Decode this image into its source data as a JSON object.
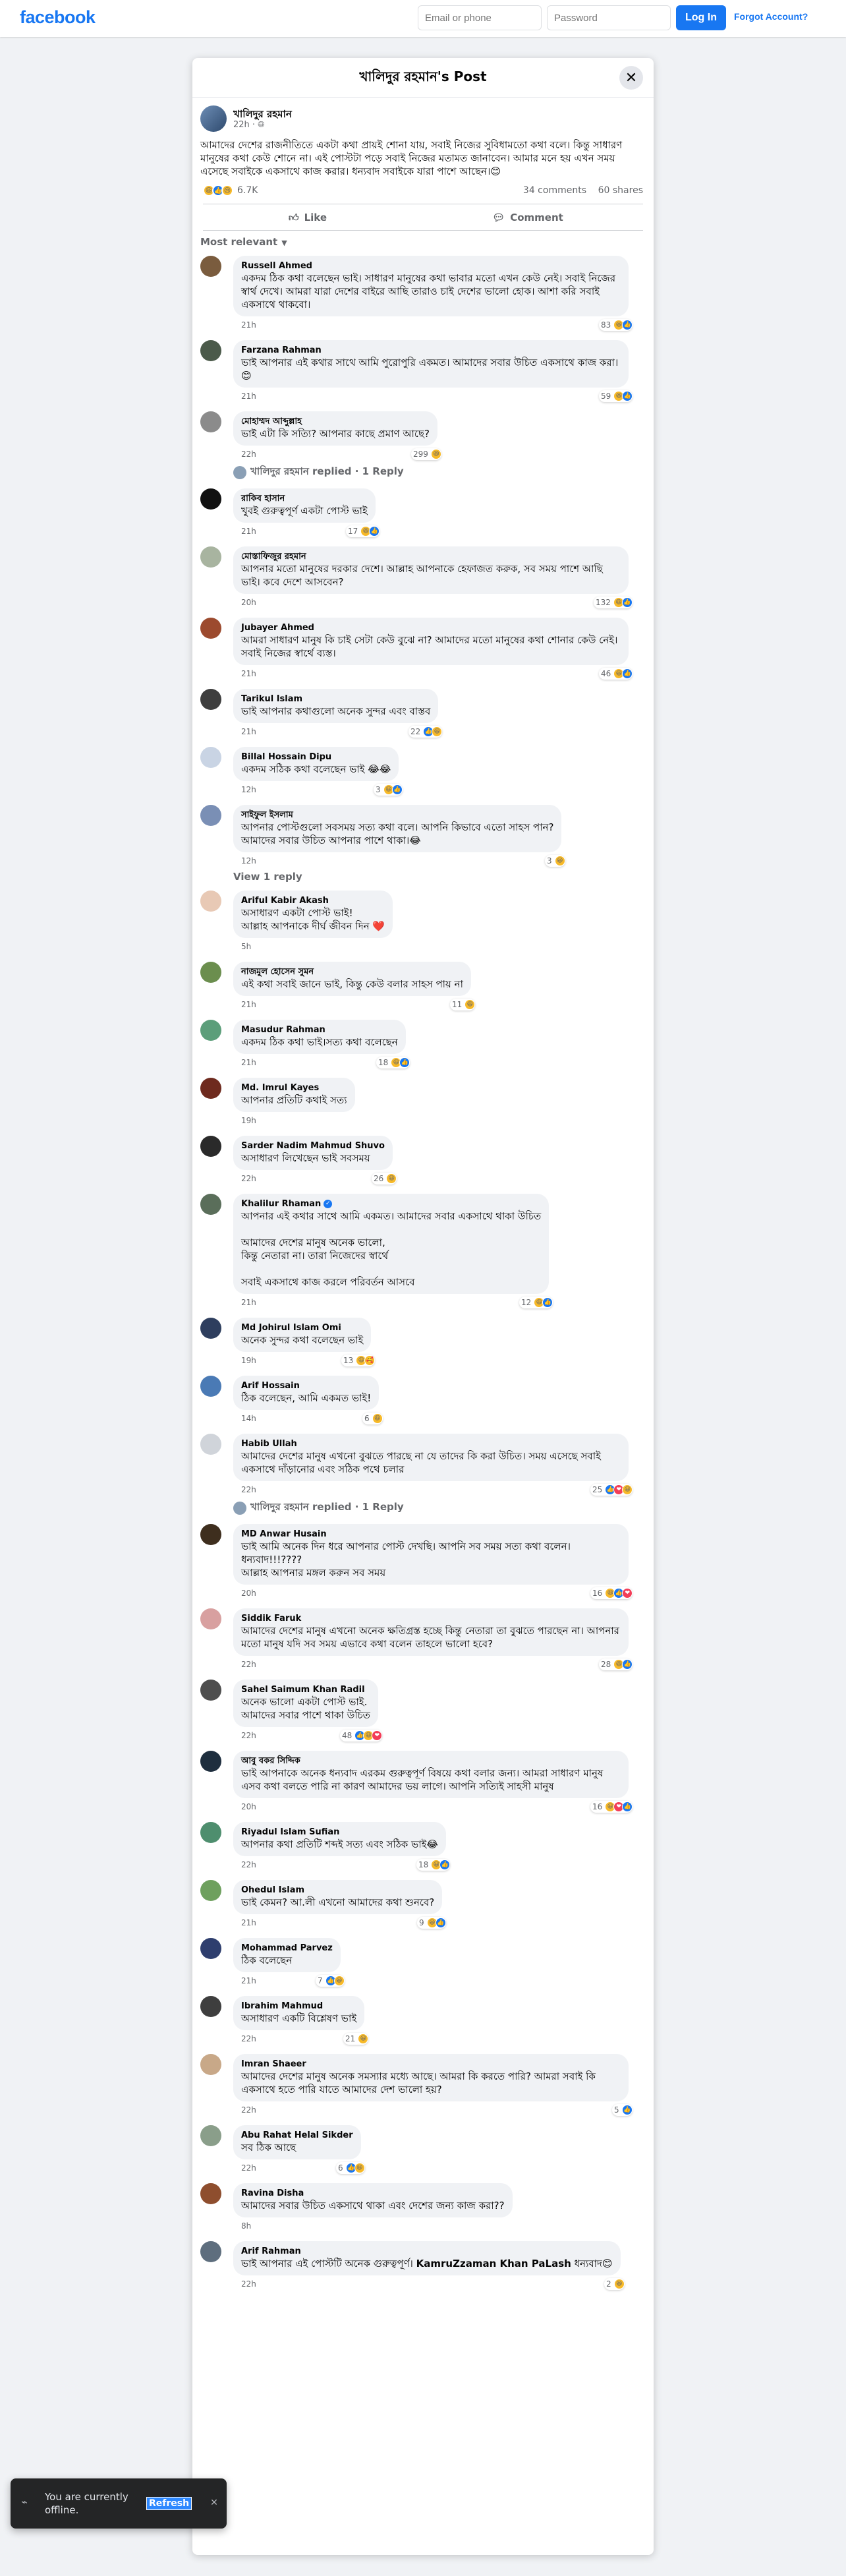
{
  "topbar": {
    "logo": "facebook",
    "email_placeholder": "Email or phone",
    "password_placeholder": "Password",
    "login_label": "Log In",
    "forgot_label": "Forgot Account?"
  },
  "dialog": {
    "title": "খালিদুর রহমান's Post",
    "close_icon": "close-icon"
  },
  "post": {
    "author": "খালিদুর রহমান",
    "time": "22h",
    "privacy_icon": "globe-icon",
    "text": "আমাদের দেশের রাজনীতিতে একটা কথা প্রায়ই শোনা যায়, সবাই নিজের সুবিধামতো কথা বলে। কিন্তু সাধারণ মানুষের কথা কেউ শোনে না। এই পোস্টটা পড়ে সবাই নিজের মতামত জানাবেন। আমার মনে হয় এখন সময় এসেছে সবাইকে একসাথে কাজ করার। ধন্যবাদ সবাইকে যারা পাশে আছেন।😊",
    "reaction_count": "6.7K",
    "comments_count": "34 comments",
    "shares_count": "60 shares",
    "like_label": "Like",
    "comment_label": "Comment",
    "sort_label": "Most relevant"
  },
  "comments": [
    {
      "name": "Russell Ahmed",
      "text": "একদম ঠিক কথা বলেছেন ভাই। সাধারণ মানুষের কথা ভাবার মতো এখন কেউ নেই। সবাই নিজের স্বার্থ দেখে। আমরা যারা দেশের বাইরে আছি তারাও চাই দেশের ভালো হোক। আশা করি সবাই একসাথে থাকবো।",
      "time": "21h",
      "count": "83",
      "reacts": [
        "haha",
        "like"
      ],
      "avatar": "#7a5c3e"
    },
    {
      "name": "Farzana Rahman",
      "text": "ভাই আপনার এই কথার সাথে আমি পুরোপুরি একমত। আমাদের সবার উচিত একসাথে কাজ করা।😊",
      "time": "21h",
      "count": "59",
      "reacts": [
        "haha",
        "like"
      ],
      "avatar": "#4b5a4a"
    },
    {
      "name": "মোহাম্মদ আব্দুল্লাহ",
      "text": "ভাই এটা কি সত্যি? আপনার কাছে প্রমাণ আছে?",
      "time": "22h",
      "count": "299",
      "reacts": [
        "haha"
      ],
      "avatar": "#8b8b8b",
      "replied": "খালিদুর রহমান replied · 1 Reply"
    },
    {
      "name": "রাকিব হাসান",
      "text": "খুবই গুরুত্বপূর্ণ একটা পোস্ট ভাই",
      "time": "21h",
      "count": "17",
      "reacts": [
        "haha",
        "like"
      ],
      "avatar": "#111111"
    },
    {
      "name": "মোস্তাফিজুর রহমান",
      "text": "আপনার মতো মানুষের দরকার দেশে। আল্লাহ আপনাকে হেফাজত করুক, সব সময় পাশে আছি ভাই। কবে দেশে আসবেন?",
      "time": "20h",
      "count": "132",
      "reacts": [
        "haha",
        "like"
      ],
      "avatar": "#a8b4a0"
    },
    {
      "name": "Jubayer Ahmed",
      "text": "আমরা সাধারণ মানুষ কি চাই সেটা কেউ বুঝে না? আমাদের মতো মানুষের কথা শোনার কেউ নেই। সবাই নিজের স্বার্থে ব্যস্ত।",
      "time": "21h",
      "count": "46",
      "reacts": [
        "haha",
        "like"
      ],
      "avatar": "#9c4a2e"
    },
    {
      "name": "Tarikul Islam",
      "text": "ভাই আপনার কথাগুলো অনেক সুন্দর এবং বাস্তব",
      "time": "21h",
      "count": "22",
      "reacts": [
        "like",
        "haha"
      ],
      "avatar": "#3e3e3e"
    },
    {
      "name": "Billal Hossain Dipu",
      "text": "একদম সঠিক কথা বলেছেন ভাই 😂😂",
      "time": "12h",
      "count": "3",
      "reacts": [
        "haha",
        "like"
      ],
      "avatar": "#c9d4e4"
    },
    {
      "name": "সাইফুল ইসলাম",
      "text": "আপনার পোস্টগুলো সবসময় সত্য কথা বলে। আপনি কিভাবে এতো সাহস পান?\nআমাদের সবার উচিত আপনার পাশে থাকা।😂",
      "time": "12h",
      "count": "3",
      "reacts": [
        "haha"
      ],
      "avatar": "#7a8fb5",
      "view_reply": "View 1 reply"
    },
    {
      "name": "Ariful Kabir Akash",
      "text": "অসাধারণ একটা পোস্ট ভাই!\nআল্লাহ আপনাকে দীর্ঘ জীবন দিন ❤️",
      "time": "5h",
      "avatar": "#e8c9b5"
    },
    {
      "name": "নাজমুল হোসেন সুমন",
      "text": "এই কথা সবাই জানে ভাই, কিন্তু কেউ বলার সাহস পায় না",
      "time": "21h",
      "count": "11",
      "reacts": [
        "haha"
      ],
      "avatar": "#6b8e4e"
    },
    {
      "name": "Masudur Rahman",
      "text": "একদম ঠিক কথা ভাই।সত্য কথা বলেছেন",
      "time": "21h",
      "count": "18",
      "reacts": [
        "haha",
        "like"
      ],
      "avatar": "#5c9e7a"
    },
    {
      "name": "Md. Imrul Kayes",
      "text": "আপনার প্রতিটি কথাই সত্য",
      "time": "19h",
      "avatar": "#6e2a1e"
    },
    {
      "name": "Sarder Nadim Mahmud Shuvo",
      "text": "অসাধারণ লিখেছেন ভাই সবসময়",
      "time": "22h",
      "count": "26",
      "reacts": [
        "haha"
      ],
      "avatar": "#2a2a2a"
    },
    {
      "name": "Khalilur Rhaman",
      "verified": true,
      "text": "আপনার এই কথার সাথে আমি একমত। আমাদের সবার একসাথে থাকা উচিত\n\nআমাদের দেশের মানুষ অনেক ভালো,\nকিন্তু নেতারা না। তারা নিজেদের স্বার্থে\n\nসবাই একসাথে কাজ করলে পরিবর্তন আসবে",
      "time": "21h",
      "count": "12",
      "reacts": [
        "haha",
        "like"
      ],
      "avatar": "#5a6e5a"
    },
    {
      "name": "Md Johirul Islam Omi",
      "text": "অনেক সুন্দর কথা বলেছেন ভাই",
      "time": "19h",
      "count": "13",
      "reacts": [
        "haha",
        "care"
      ],
      "avatar": "#2e3e5e"
    },
    {
      "name": "Arif Hossain",
      "text": "ঠিক বলেছেন, আমি একমত ভাই!",
      "time": "14h",
      "count": "6",
      "reacts": [
        "haha"
      ],
      "avatar": "#4a7ab5"
    },
    {
      "name": "Habib Ullah",
      "text": "আমাদের দেশের মানুষ এখনো বুঝতে পারছে না যে তাদের কি করা উচিত। সময় এসেছে সবাই একসাথে দাঁড়ানোর এবং সঠিক পথে চলার",
      "time": "22h",
      "count": "25",
      "reacts": [
        "like",
        "love",
        "haha"
      ],
      "avatar": "#d0d4da",
      "replied": "খালিদুর রহমান replied · 1 Reply"
    },
    {
      "name": "MD Anwar Husain",
      "text": "ভাই আমি অনেক দিন ধরে আপনার পোস্ট দেখছি। আপনি সব সময় সত্য কথা বলেন। ধন্যবাদ!!!????\nআল্লাহ আপনার মঙ্গল করুন সব সময়",
      "time": "20h",
      "count": "16",
      "reacts": [
        "haha",
        "like",
        "love"
      ],
      "avatar": "#3e2e1e"
    },
    {
      "name": "Siddik Faruk",
      "text": "আমাদের দেশের মানুষ এখনো অনেক ক্ষতিগ্রস্ত হচ্ছে কিন্তু নেতারা তা বুঝতে পারছেন না। আপনার মতো মানুষ যদি সব সময় এভাবে কথা বলেন তাহলে ভালো হবে?",
      "time": "22h",
      "count": "28",
      "reacts": [
        "haha",
        "like"
      ],
      "avatar": "#d8a0a0"
    },
    {
      "name": "Sahel Saimum Khan Radil",
      "text": "অনেক ভালো একটা পোস্ট ভাই.\nআমাদের সবার পাশে থাকা উচিত",
      "time": "22h",
      "count": "48",
      "reacts": [
        "like",
        "haha",
        "love"
      ],
      "avatar": "#4e4e4e"
    },
    {
      "name": "আবু বকর সিদ্দিক",
      "text": "ভাই আপনাকে অনেক ধন্যবাদ এরকম গুরুত্বপূর্ণ বিষয়ে কথা বলার জন্য। আমরা সাধারণ মানুষ এসব কথা বলতে পারি না কারণ আমাদের ভয় লাগে। আপনি সত্যিই সাহসী মানুষ",
      "time": "20h",
      "count": "16",
      "reacts": [
        "haha",
        "love",
        "like"
      ],
      "avatar": "#1e2e3e"
    },
    {
      "name": "Riyadul Islam Sufian",
      "text": "আপনার কথা প্রতিটি শব্দই সত্য এবং সঠিক ভাই😂",
      "time": "22h",
      "count": "18",
      "reacts": [
        "haha",
        "like"
      ],
      "avatar": "#4e8e6e"
    },
    {
      "name": "Ohedul Islam",
      "text": "ভাই কেমন? আ.লী এখনো আমাদের কথা শুনবে?",
      "time": "21h",
      "count": "9",
      "reacts": [
        "haha",
        "like"
      ],
      "avatar": "#6ea05e"
    },
    {
      "name": "Mohammad Parvez",
      "text": "ঠিক বলেছেন",
      "time": "21h",
      "count": "7",
      "reacts": [
        "like",
        "haha"
      ],
      "avatar": "#2e3e6e"
    },
    {
      "name": "Ibrahim Mahmud",
      "text": "অসাধারণ একটি বিশ্লেষণ ভাই",
      "time": "22h",
      "count": "21",
      "reacts": [
        "haha"
      ],
      "avatar": "#3e3e3e"
    },
    {
      "name": "Imran Shaeer",
      "text": "আমাদের দেশের মানুষ অনেক সমস্যার মধ্যে আছে। আমরা কি করতে পারি? আমরা সবাই কি একসাথে হতে পারি যাতে আমাদের দেশ ভালো হয়?",
      "time": "22h",
      "count": "5",
      "reacts": [
        "like"
      ],
      "avatar": "#c8a888"
    },
    {
      "name": "Abu Rahat Helal Sikder",
      "text": "সব ঠিক আছে",
      "time": "22h",
      "count": "6",
      "reacts": [
        "like",
        "haha"
      ],
      "avatar": "#8a9e8a"
    },
    {
      "name": "Ravina Disha",
      "text": "আমাদের সবার উচিত একসাথে থাকা এবং দেশের জন্য কাজ করা??",
      "time": "8h",
      "avatar": "#8e4e2e"
    },
    {
      "name": "Arif Rahman",
      "text": "ভাই আপনার এই পোস্টটি অনেক গুরুত্বপূর্ণ।",
      "mention": "KamruZzaman Khan PaLash",
      "text_after": " ধন্যবাদ😊",
      "time": "22h",
      "count": "2",
      "reacts": [
        "haha"
      ],
      "avatar": "#5e6e7e"
    }
  ],
  "toast": {
    "message": "You are currently offline.",
    "refresh_label": "Refresh",
    "wifi_icon": "wifi-off-icon",
    "close_icon": "close-icon"
  }
}
